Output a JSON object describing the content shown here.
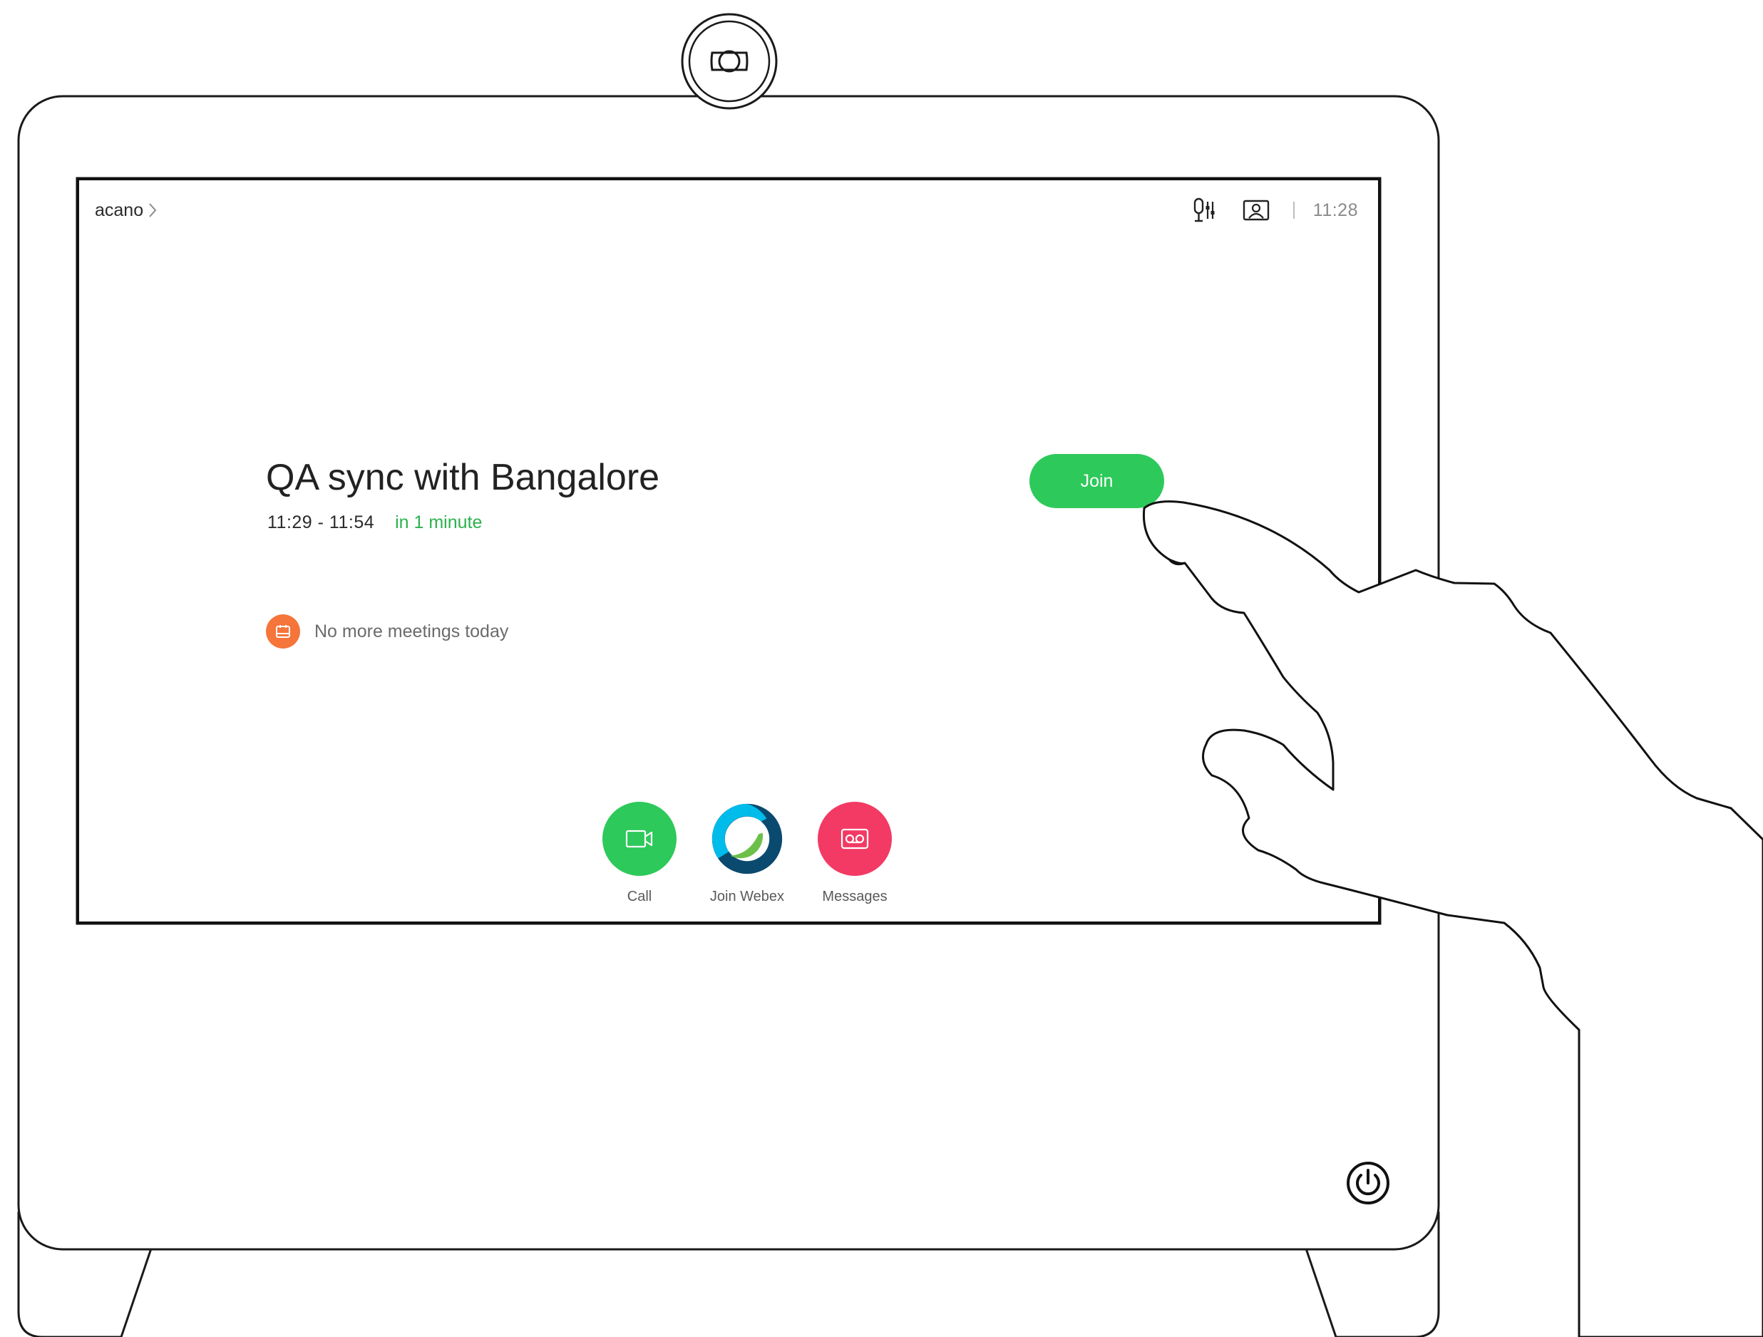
{
  "header": {
    "device_name": "acano",
    "clock": "11:28"
  },
  "meeting": {
    "title": "QA sync with Bangalore",
    "time_range": "11:29 - 11:54",
    "relative_time": "in 1 minute",
    "join_label": "Join"
  },
  "schedule": {
    "status_text": "No more meetings today"
  },
  "actions": [
    {
      "label": "Call",
      "icon": "video-camera-icon",
      "color": "#2dc95a"
    },
    {
      "label": "Join Webex",
      "icon": "webex-icon",
      "color": "#00bceb"
    },
    {
      "label": "Messages",
      "icon": "voicemail-icon",
      "color": "#f23a64"
    }
  ],
  "colors": {
    "accent_green": "#2dc95a",
    "relative_time_green": "#2bb24c",
    "calendar_orange": "#f5753a",
    "messages_pink": "#f23a64",
    "webex_cyan": "#00bceb",
    "webex_navy": "#0b4a6f",
    "webex_green": "#6cc04a"
  }
}
